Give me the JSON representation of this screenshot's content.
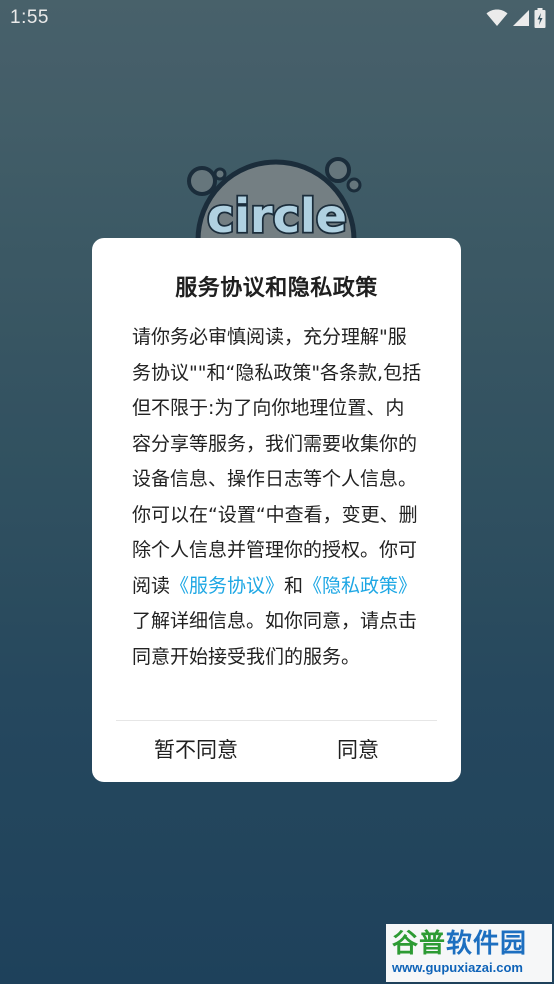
{
  "status_bar": {
    "time": "1:55",
    "icons": [
      "wifi-icon",
      "signal-icon",
      "battery-charging-icon"
    ]
  },
  "app": {
    "logo_text": "circle"
  },
  "dialog": {
    "title": "服务协议和隐私政策",
    "body_part1": "请你务必审慎阅读，充分理解\"服务协议\"\"和“隐私政策\"各条款,包括但不限于:为了向你地理位置、内容分享等服务，我们需要收集你的设备信息、操作日志等个人信息。你可以在“设置“中查看，变更、删除个人信息并管理你的授权。你可阅读",
    "link_service": "《服务协议》",
    "body_and": "和",
    "link_privacy": "《隐私政策》",
    "body_part2": "了解详细信息。如你同意，请点击同意开始接受我们的服务。",
    "disagree_label": "暂不同意",
    "agree_label": "同意",
    "link_color": "#1ea7e4"
  },
  "watermark": {
    "title_part1": "谷普",
    "title_part2": "软件园",
    "url": "www.gupuxiazai.com"
  }
}
